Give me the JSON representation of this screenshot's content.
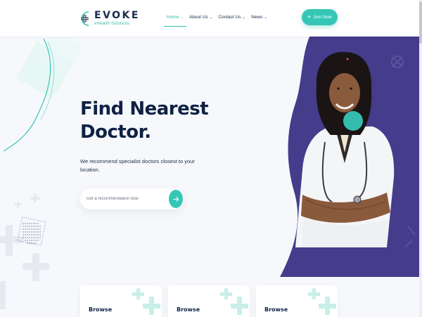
{
  "brand": {
    "title": "EVOKE",
    "subtitle": "eHealth Solutions"
  },
  "nav": {
    "items": [
      {
        "label": "Home",
        "active": true
      },
      {
        "label": "About Us",
        "active": false
      },
      {
        "label": "Contact Us",
        "active": false
      },
      {
        "label": "News",
        "active": false
      }
    ],
    "chevron": "⌄"
  },
  "header": {
    "cta_label": "Join Now",
    "cta_icon": "plus-icon"
  },
  "hero": {
    "headline_line1": "Find Nearest",
    "headline_line2": "Doctor.",
    "description": "We recommend specialist doctors closest to your location.",
    "search_placeholder": "Get a recommendation now",
    "search_button_icon": "arrow-right-icon"
  },
  "cards": [
    {
      "title": "Browse"
    },
    {
      "title": "Browse"
    },
    {
      "title": "Browse"
    }
  ],
  "colors": {
    "accent": "#36c6b6",
    "navy": "#0f2244",
    "purple_panel": "#453c8c",
    "background": "#f6f8fb"
  }
}
